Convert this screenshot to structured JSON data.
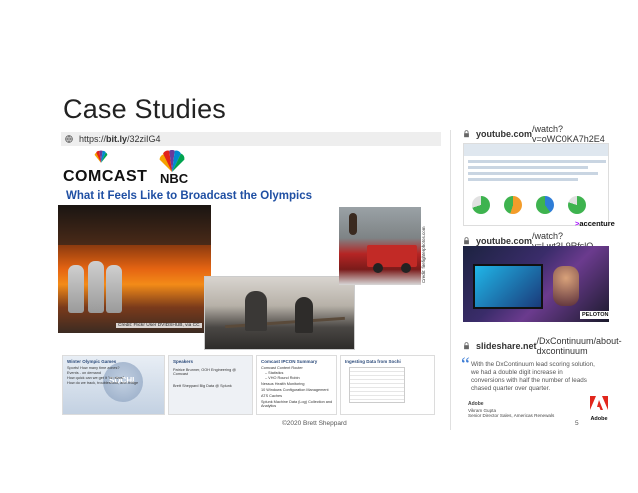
{
  "slide": {
    "title": "Case Studies",
    "footer": "©2020 Brett Sheppard",
    "page_number": "5"
  },
  "left_panel": {
    "url_prefix": "https://",
    "url_bold": "bit.ly",
    "url_rest": "/32ziIG4",
    "logo_comcast": "COMCAST",
    "logo_nbc": "NBC",
    "headline": "What it Feels Like to Broadcast the Olympics",
    "photo_credit_1": "Credit: Flickr User DVIDSHUB, via CC",
    "photo_credit_2": "Credit: firefighterphotos.com",
    "minis": [
      {
        "title": "Winter Olympic Games",
        "lines": [
          "Sports! How many time zones?",
          "Events - on demand",
          "How quick can we get it \"on stars\"",
          "How do we track, troubleshoot, and bridge"
        ],
        "badge": "SOCHI"
      },
      {
        "title": "Speakers",
        "lines": [
          "Patrice Brunner, OOH Engineering @ Comcast",
          "",
          "Brett Sheppard Big Data @ Splunk"
        ]
      },
      {
        "title": "Comcast IPCON Summary",
        "lines": [
          "Comcast Content Router",
          "– Statistics",
          "– VHO Round Robin",
          "Nessus Health Monitoring",
          "10 Windows Configuration Management",
          "ATS Caches",
          "Splunk Machine Data (Log) Collection and Analytics"
        ]
      },
      {
        "title": "Ingesting Data from Sochi",
        "lines": []
      }
    ]
  },
  "right_column": {
    "items": [
      {
        "url_bold": "youtube.com",
        "url_rest": "/watch?v=oWC0KA7h2E4",
        "brand": "accenture"
      },
      {
        "url_bold": "youtube.com",
        "url_rest": "/watch?v=Lwt3L9RfslQ",
        "brand": "PELOTON"
      },
      {
        "url_bold": "slideshare.net",
        "url_rest": "/DxContinuum/about-dxcontinuum",
        "brand": "Adobe"
      }
    ],
    "quote": "With the DxContinuum lead scoring solution, we had a double digit increase in conversions with half the number of leads chased quarter over quarter.",
    "adobe_small_lines": [
      "Adobe",
      "Vikram Gupta",
      "Senior Director Sales, Americas Renewals"
    ]
  },
  "colors": {
    "headline_blue": "#1f4fa3",
    "quote_blue": "#3a7bd5",
    "url_bar_gray": "#eeeeee",
    "adobe_red": "#e1261c",
    "accenture_purple": "#a100ff"
  },
  "icons": {
    "url_bar_left": "globe-icon",
    "url_bar_right": "lock-icon"
  }
}
